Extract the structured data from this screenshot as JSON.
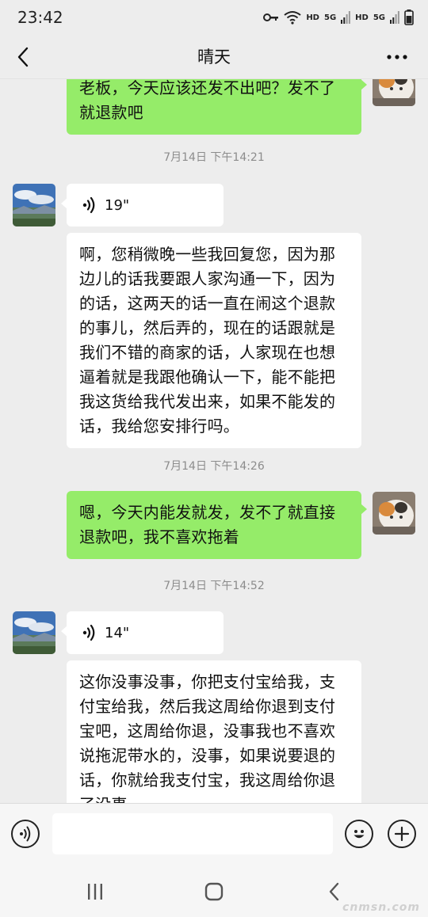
{
  "status_bar": {
    "time": "23:42",
    "indicators": [
      "HD",
      "5G",
      "HD",
      "5G"
    ],
    "icons": [
      "key-icon",
      "wifi-icon",
      "signal-icon",
      "signal-icon",
      "battery-icon"
    ]
  },
  "header": {
    "title": "晴天",
    "back_icon": "chevron-left-icon",
    "more_icon": "more-dots-icon"
  },
  "messages": [
    {
      "type": "text",
      "from": "me",
      "text": "老板，今天应该还发不出吧？发不了就退款吧"
    },
    {
      "type": "timestamp",
      "text": "7月14日 下午14:21"
    },
    {
      "type": "voice",
      "from": "other",
      "duration": "19\""
    },
    {
      "type": "text",
      "from": "other",
      "text": "啊，您稍微晚一些我回复您，因为那边儿的话我要跟人家沟通一下，因为的话，这两天的话一直在闹这个退款的事儿，然后弄的，现在的话跟就是我们不错的商家的话，人家现在也想逼着就是我跟他确认一下，能不能把我这货给我代发出来，如果不能发的话，我给您安排行吗。"
    },
    {
      "type": "timestamp",
      "text": "7月14日 下午14:26"
    },
    {
      "type": "text",
      "from": "me",
      "text": "嗯，今天内能发就发，发不了就直接退款吧，我不喜欢拖着"
    },
    {
      "type": "timestamp",
      "text": "7月14日 下午14:52"
    },
    {
      "type": "voice",
      "from": "other",
      "duration": "14\""
    },
    {
      "type": "text",
      "from": "other",
      "text": "这你没事没事，你把支付宝给我，支付宝给我，然后我这周给你退到支付宝吧，这周给你退，没事我也不喜欢说拖泥带水的，没事，如果说要退的话，你就给我支付宝，我这周给你退了没事。"
    }
  ],
  "input_bar": {
    "voice_icon": "voice-input-icon",
    "placeholder": "",
    "emoji_icon": "emoji-icon",
    "add_icon": "plus-icon"
  },
  "nav_bar": {
    "icons": [
      "recent-apps-icon",
      "home-icon",
      "back-icon"
    ]
  },
  "watermark": "cnmsn.com"
}
